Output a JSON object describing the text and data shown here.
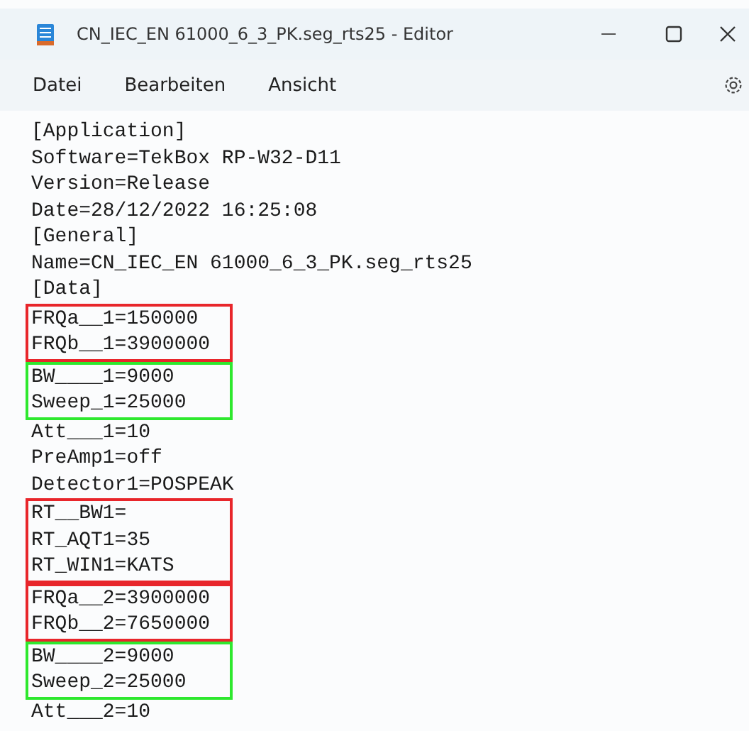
{
  "window": {
    "title": "CN_IEC_EN 61000_6_3_PK.seg_rts25 - Editor"
  },
  "menu": [
    {
      "label": "Datei"
    },
    {
      "label": "Bearbeiten"
    },
    {
      "label": "Ansicht"
    }
  ],
  "blocks": [
    {
      "lines": [
        "[Application]",
        "Software=TekBox RP-W32-D11",
        "Version=Release",
        "Date=28/12/2022 16:25:08",
        "[General]",
        "Name=CN_IEC_EN 61000_6_3_PK.seg_rts25",
        "[Data]"
      ]
    },
    {
      "color": "#e8262b",
      "lines": [
        "FRQa__1=150000",
        "FRQb__1=3900000"
      ]
    },
    {
      "color": "#2ee82e",
      "lines": [
        "BW____1=9000",
        "Sweep_1=25000"
      ]
    },
    {
      "lines": [
        "Att___1=10",
        "PreAmp1=off",
        "Detector1=POSPEAK"
      ]
    },
    {
      "color": "#e8262b",
      "lines": [
        "RT__BW1=",
        "RT_AQT1=35",
        "RT_WIN1=KATS"
      ]
    },
    {
      "color": "#e8262b",
      "lines": [
        "FRQa__2=3900000",
        "FRQb__2=7650000"
      ]
    },
    {
      "color": "#2ee82e",
      "lines": [
        "BW____2=9000",
        "Sweep_2=25000"
      ]
    },
    {
      "lines": [
        "Att___2=10"
      ]
    }
  ]
}
